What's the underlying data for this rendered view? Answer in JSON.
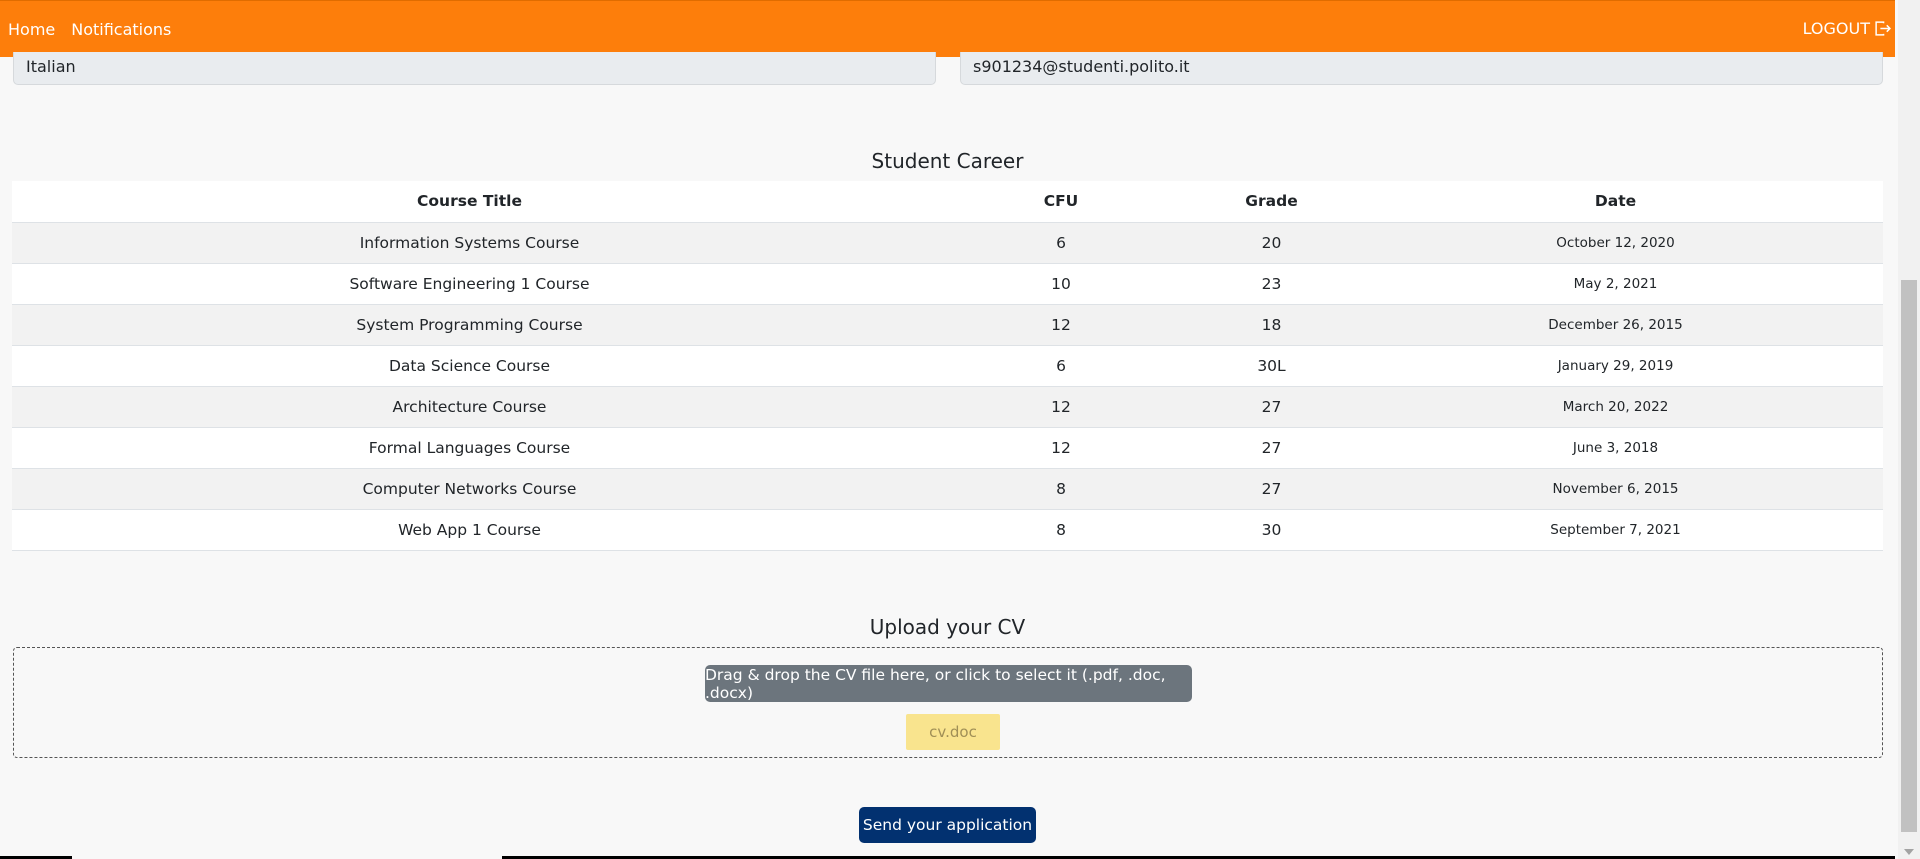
{
  "nav": {
    "home": "Home",
    "notifications": "Notifications",
    "logout": "LOGOUT",
    "logout_icon": "logout-icon",
    "accent_color": "#fd7e0b"
  },
  "profile": {
    "nationality": "Italian",
    "email": "s901234@studenti.polito.it"
  },
  "career": {
    "title": "Student Career",
    "headers": [
      "Course Title",
      "CFU",
      "Grade",
      "Date"
    ],
    "rows": [
      [
        "Information Systems Course",
        "6",
        "20",
        "October 12, 2020"
      ],
      [
        "Software Engineering 1 Course",
        "10",
        "23",
        "May 2, 2021"
      ],
      [
        "System Programming Course",
        "12",
        "18",
        "December 26, 2015"
      ],
      [
        "Data Science Course",
        "6",
        "30L",
        "January 29, 2019"
      ],
      [
        "Architecture Course",
        "12",
        "27",
        "March 20, 2022"
      ],
      [
        "Formal Languages Course",
        "12",
        "27",
        "June 3, 2018"
      ],
      [
        "Computer Networks Course",
        "8",
        "27",
        "November 6, 2015"
      ],
      [
        "Web App 1 Course",
        "8",
        "30",
        "September 7, 2021"
      ]
    ]
  },
  "upload": {
    "title": "Upload your CV",
    "dropzone_label": "Drag & drop the CV file here, or click to select it (.pdf, .doc, .docx)",
    "file_name": "cv.doc"
  },
  "actions": {
    "send_label": "Send your application",
    "send_color": "#023170"
  }
}
